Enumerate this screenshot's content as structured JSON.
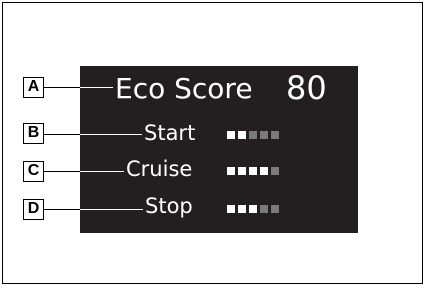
{
  "callouts": {
    "a": "A",
    "b": "B",
    "c": "C",
    "d": "D"
  },
  "display": {
    "title": "Eco Score",
    "score": "80",
    "rows": [
      {
        "label": "Start",
        "level": 2,
        "max": 5
      },
      {
        "label": "Cruise",
        "level": 4,
        "max": 5
      },
      {
        "label": "Stop",
        "level": 3,
        "max": 5
      }
    ]
  },
  "colors": {
    "panel": "#231f20",
    "active_segment": "#ffffff",
    "inactive_segment": "#7a7a7a"
  }
}
